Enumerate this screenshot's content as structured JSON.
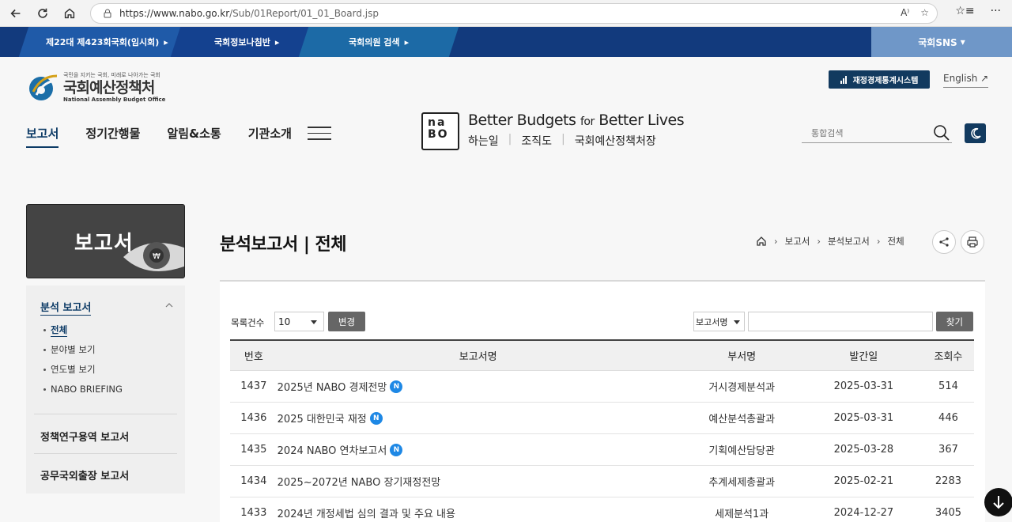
{
  "browser": {
    "url_host": "https://www.nabo.go.kr",
    "url_path": "/Sub/01Report/01_01_Board.jsp"
  },
  "gov_strip": {
    "assembly_session": "제22대 제423회국회(임시회)",
    "info_link": "국회정보나침반",
    "member_search": "국회의원 검색",
    "sns": "국회SNS"
  },
  "header": {
    "logo_slogan": "국민을 지키는 국회, 미래로 나아가는 국회",
    "logo_title": "국회예산정책처",
    "logo_en": "National Assembly Budget Office",
    "stats_button": "재정경제통계시스템",
    "english_link": "English",
    "nav": [
      "보고서",
      "정기간행물",
      "알림&소통",
      "기관소개"
    ],
    "nabo_line1": "na",
    "nabo_line2": "BO",
    "tagline_part1": "Better Budgets",
    "tagline_for": "for",
    "tagline_part2": "Better Lives",
    "sub_links": [
      "하는일",
      "조직도",
      "국회예산정책처장"
    ],
    "search_placeholder": "통합검색"
  },
  "sidebar": {
    "hero_title": "보고서",
    "group_title": "분석 보고서",
    "sub_items": [
      "전체",
      "분야별 보기",
      "연도별 보기",
      "NABO BRIEFING"
    ],
    "links": [
      "정책연구용역 보고서",
      "공무국외출장 보고서"
    ]
  },
  "content": {
    "title": "분석보고서 | 전체",
    "breadcrumb": [
      "보고서",
      "분석보고서",
      "전체"
    ],
    "count_label": "목록건수",
    "count_value": "10",
    "change_button": "변경",
    "field_select": "보고서명",
    "find_button": "찾기",
    "columns": [
      "번호",
      "보고서명",
      "부서명",
      "발간일",
      "조회수"
    ],
    "new_badge": "N",
    "rows": [
      {
        "num": "1437",
        "title": "2025년 NABO 경제전망",
        "new": true,
        "dept": "거시경제분석과",
        "date": "2025-03-31",
        "views": "514"
      },
      {
        "num": "1436",
        "title": "2025 대한민국 재정",
        "new": true,
        "dept": "예산분석총괄과",
        "date": "2025-03-31",
        "views": "446"
      },
      {
        "num": "1435",
        "title": "2024 NABO 연차보고서",
        "new": true,
        "dept": "기획예산담당관",
        "date": "2025-03-28",
        "views": "367"
      },
      {
        "num": "1434",
        "title": "2025~2072년 NABO 장기재정전망",
        "new": false,
        "dept": "추계세제총괄과",
        "date": "2025-02-21",
        "views": "2283"
      },
      {
        "num": "1433",
        "title": "2024년 개정세법 심의 결과 및 주요 내용",
        "new": false,
        "dept": "세제분석1과",
        "date": "2024-12-27",
        "views": "3405"
      }
    ]
  }
}
